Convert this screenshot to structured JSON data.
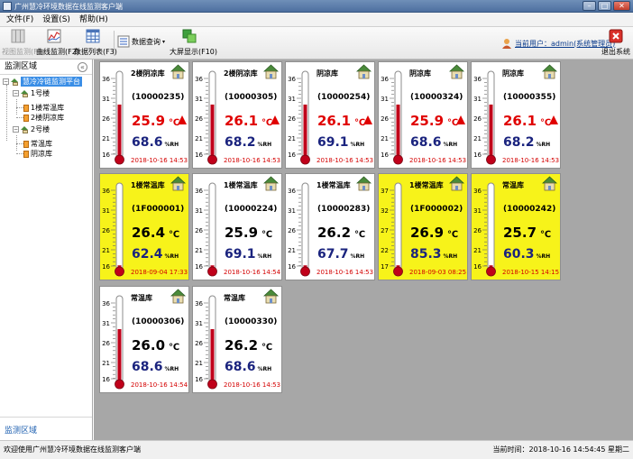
{
  "window": {
    "title": "广州慧冷环境数据在线监测客户端"
  },
  "menu": [
    "文件(F)",
    "设置(S)",
    "帮助(H)"
  ],
  "toolbar": {
    "buttons": [
      {
        "label": "视图监测(F1)",
        "icon": "grid-view-icon",
        "enabled": false
      },
      {
        "label": "曲线监测(F2)",
        "icon": "curve-chart-icon",
        "enabled": true
      },
      {
        "label": "数据列表(F3)",
        "icon": "table-icon",
        "enabled": true
      },
      {
        "label": "数据查询",
        "icon": "query-list-icon",
        "enabled": true
      },
      {
        "label": "大屏显示(F10)",
        "icon": "big-screen-icon",
        "enabled": true
      }
    ],
    "current_user": "当前用户：admin(系统管理员)",
    "exit_label": "退出系统"
  },
  "sidebar": {
    "header": "监测区域",
    "footer": "监测区域",
    "tree": {
      "root": "慧冷冷链监测平台",
      "groups": [
        {
          "name": "1号楼",
          "items": [
            "1楼常温库",
            "2楼阴凉库"
          ]
        },
        {
          "name": "2号楼",
          "items": [
            "常温库",
            "阴凉库"
          ]
        }
      ]
    }
  },
  "scale": {
    "normal": [
      "36",
      "31",
      "26",
      "21",
      "16"
    ],
    "shifted": [
      "37",
      "32",
      "27",
      "22",
      "17"
    ]
  },
  "cards": [
    {
      "name": "2楼阴凉库",
      "id": "(10000235)",
      "temp": "25.9",
      "hum": "68.6",
      "time": "2018-10-16 14:53",
      "alarm": false,
      "temp_warn": true,
      "scale": "normal",
      "fill": 0.62
    },
    {
      "name": "2楼阴凉库",
      "id": "(10000305)",
      "temp": "26.1",
      "hum": "68.2",
      "time": "2018-10-16 14:53",
      "alarm": false,
      "temp_warn": true,
      "scale": "normal",
      "fill": 0.62
    },
    {
      "name": "阴凉库",
      "id": "(10000254)",
      "temp": "26.1",
      "hum": "69.1",
      "time": "2018-10-16 14:53",
      "alarm": false,
      "temp_warn": true,
      "scale": "normal",
      "fill": 0.62
    },
    {
      "name": "阴凉库",
      "id": "(10000324)",
      "temp": "25.9",
      "hum": "68.6",
      "time": "2018-10-16 14:53",
      "alarm": false,
      "temp_warn": true,
      "scale": "normal",
      "fill": 0.62
    },
    {
      "name": "阴凉库",
      "id": "(10000355)",
      "temp": "26.1",
      "hum": "68.2",
      "time": "2018-10-16 14:53",
      "alarm": false,
      "temp_warn": true,
      "scale": "normal",
      "fill": 0.62
    },
    {
      "name": "1楼常温库",
      "id": "(1F000001)",
      "temp": "26.4",
      "hum": "62.4",
      "time": "2018-09-04 17:33",
      "alarm": true,
      "temp_warn": false,
      "scale": "normal",
      "fill": 0.03
    },
    {
      "name": "1楼常温库",
      "id": "(10000224)",
      "temp": "25.9",
      "hum": "69.1",
      "time": "2018-10-16 14:54",
      "alarm": false,
      "temp_warn": false,
      "scale": "normal",
      "fill": 0.03
    },
    {
      "name": "1楼常温库",
      "id": "(10000283)",
      "temp": "26.2",
      "hum": "67.7",
      "time": "2018-10-16 14:53",
      "alarm": false,
      "temp_warn": false,
      "scale": "normal",
      "fill": 0.03
    },
    {
      "name": "1楼常温库",
      "id": "(1F000002)",
      "temp": "26.9",
      "hum": "85.3",
      "time": "2018-09-03 08:25",
      "alarm": true,
      "temp_warn": false,
      "scale": "shifted",
      "fill": 0.03
    },
    {
      "name": "常温库",
      "id": "(10000242)",
      "temp": "25.7",
      "hum": "60.3",
      "time": "2018-10-15 14:15",
      "alarm": true,
      "temp_warn": false,
      "scale": "normal",
      "fill": 0.03
    },
    {
      "name": "常温库",
      "id": "(10000306)",
      "temp": "26.0",
      "hum": "68.6",
      "time": "2018-10-16 14:54",
      "alarm": false,
      "temp_warn": false,
      "scale": "normal",
      "fill": 0.62
    },
    {
      "name": "常温库",
      "id": "(10000330)",
      "temp": "26.2",
      "hum": "68.6",
      "time": "2018-10-16 14:53",
      "alarm": false,
      "temp_warn": false,
      "scale": "normal",
      "fill": 0.62
    }
  ],
  "units": {
    "temp": "℃",
    "hum": "%RH"
  },
  "status": {
    "welcome": "欢迎使用广州慧冷环境数据在线监测客户端",
    "time": "当前时间：2018-10-16 14:54:45 星期二"
  },
  "colors": {
    "alarm_bg": "#f7f31a",
    "temp_alarm": "#e00000",
    "hum": "#1a237e",
    "time": "#d40000",
    "select": "#3a8ee6"
  }
}
